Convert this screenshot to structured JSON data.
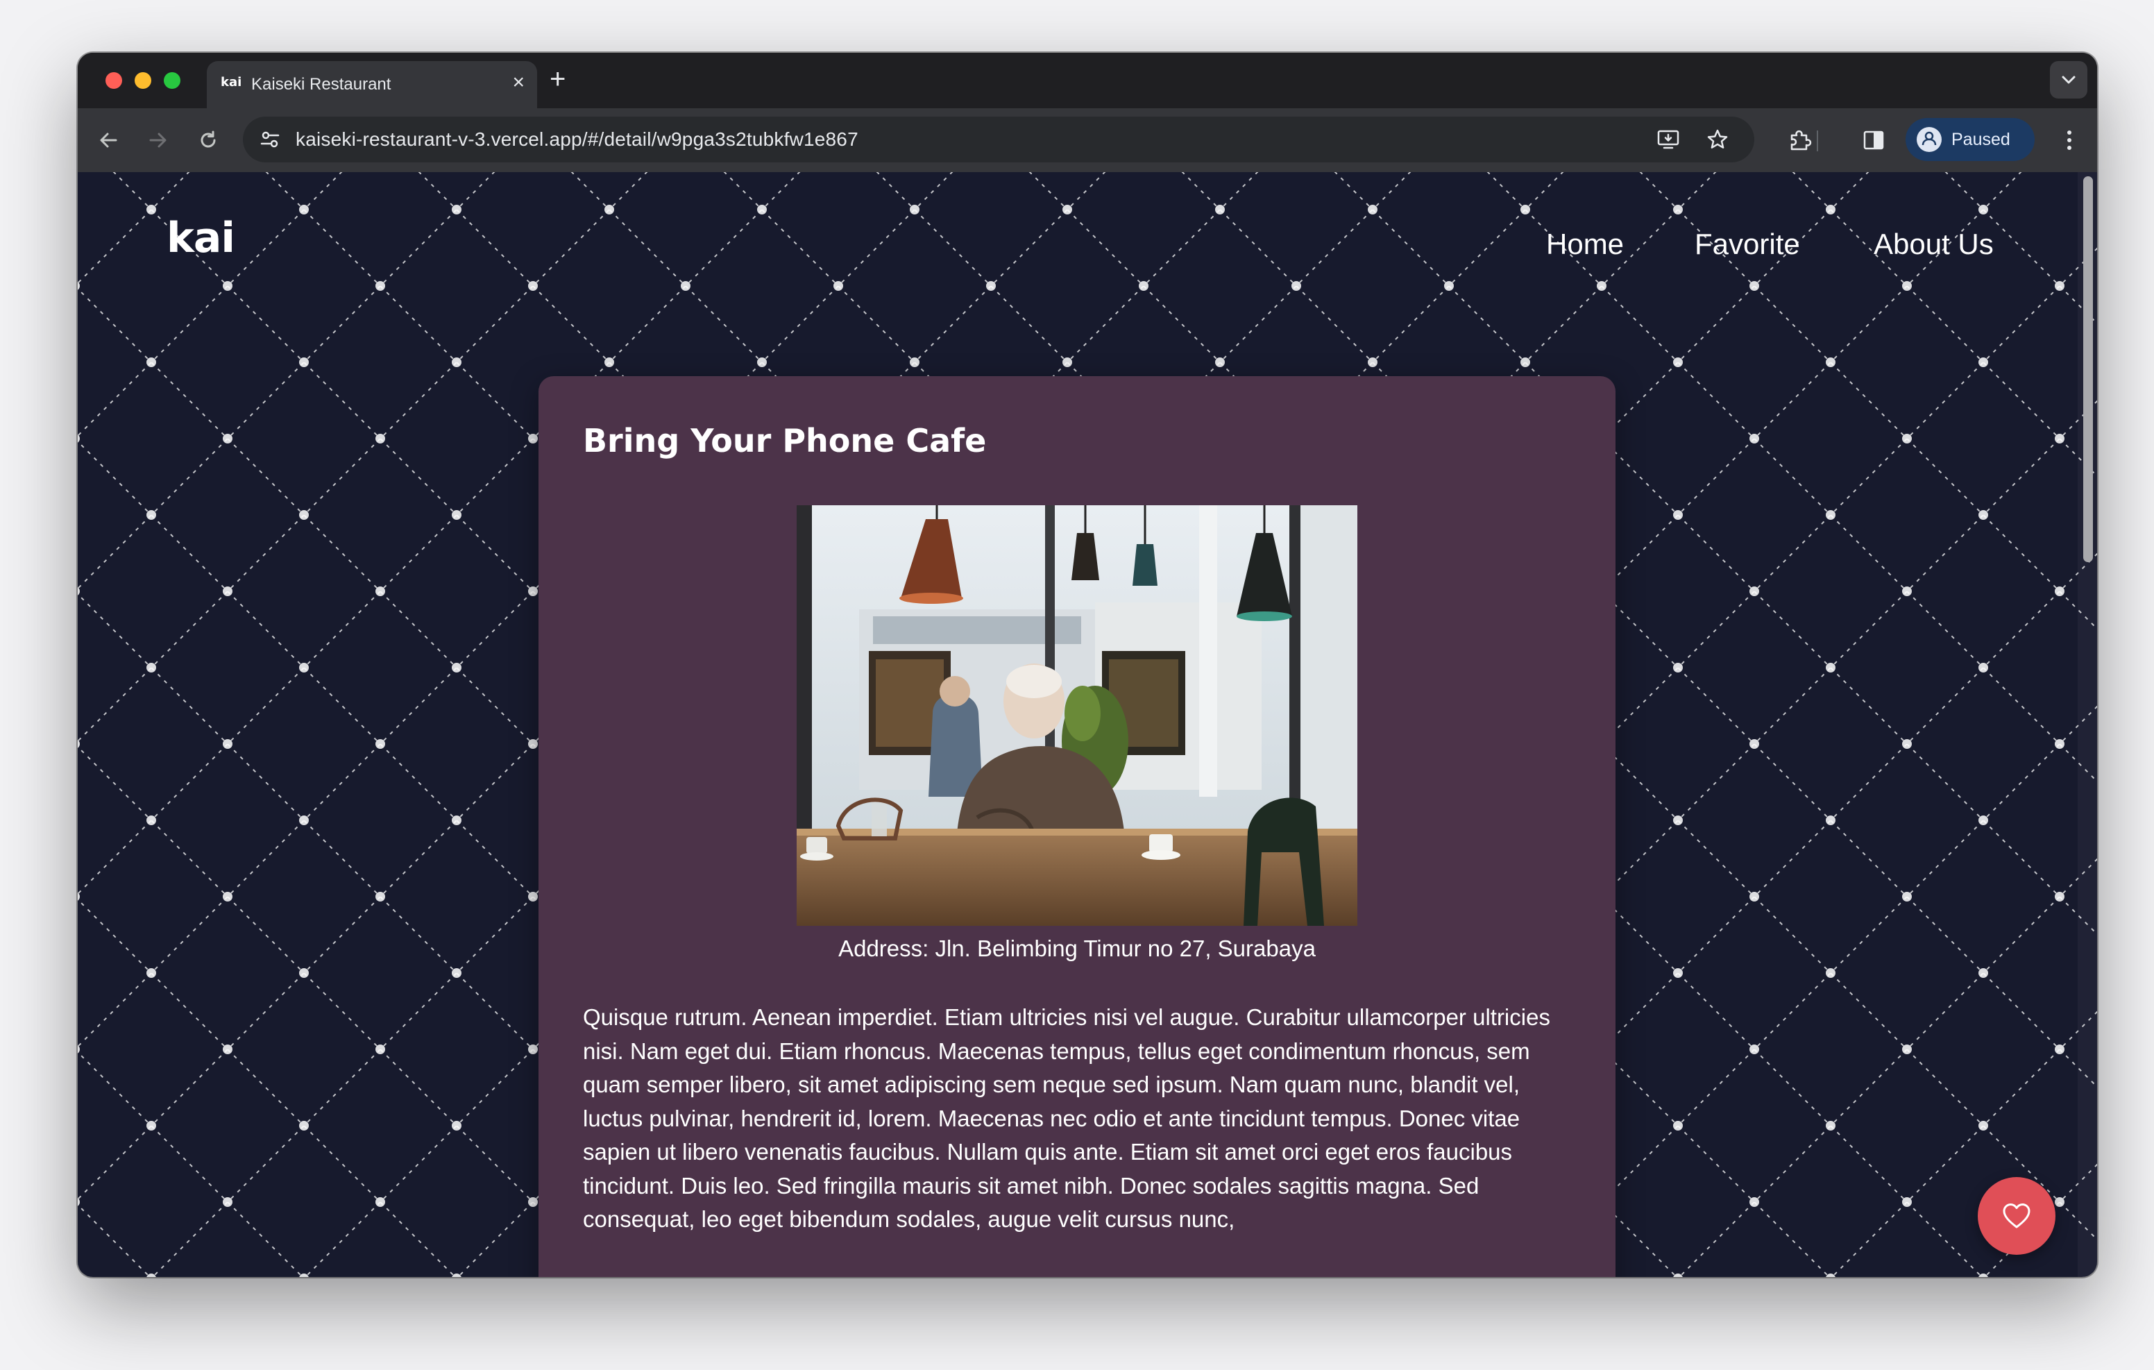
{
  "browser": {
    "tab": {
      "favicon_text": "kai",
      "title": "Kaiseki Restaurant",
      "close_glyph": "×"
    },
    "new_tab_glyph": "+",
    "url": "kaiseki-restaurant-v-3.vercel.app/#/detail/w9pga3s2tubkfw1e867",
    "profile_label": "Paused",
    "icons": {
      "back": "back-arrow-icon",
      "forward": "forward-arrow-icon",
      "reload": "reload-icon",
      "site_info": "tune-icon",
      "install": "install-app-icon",
      "bookmark": "star-icon",
      "extensions": "puzzle-icon",
      "side_panel": "side-panel-icon",
      "menu": "kebab-menu-icon",
      "tab_search": "chevron-down-icon"
    },
    "accent_profile": "#1c3a63"
  },
  "site": {
    "logo": "kai",
    "nav": {
      "home": "Home",
      "favorite": "Favorite",
      "about": "About Us"
    },
    "colors": {
      "background": "#171a2d",
      "card": "#4c3349",
      "favorite_button": "#e04f57"
    }
  },
  "detail": {
    "name": "Bring Your Phone Cafe",
    "address": "Address: Jln. Belimbing Timur no 27, Surabaya",
    "description": "Quisque rutrum. Aenean imperdiet. Etiam ultricies nisi vel augue. Curabitur ullamcorper ultricies nisi. Nam eget dui. Etiam rhoncus. Maecenas tempus, tellus eget condimentum rhoncus, sem quam semper libero, sit amet adipiscing sem neque sed ipsum. Nam quam nunc, blandit vel, luctus pulvinar, hendrerit id, lorem. Maecenas nec odio et ante tincidunt tempus. Donec vitae sapien ut libero venenatis faucibus. Nullam quis ante. Etiam sit amet orci eget eros faucibus tincidunt. Duis leo. Sed fringilla mauris sit amet nibh. Donec sodales sagittis magna. Sed consequat, leo eget bibendum sodales, augue velit cursus nunc,",
    "favorite_icon": "heart-outline-icon"
  }
}
